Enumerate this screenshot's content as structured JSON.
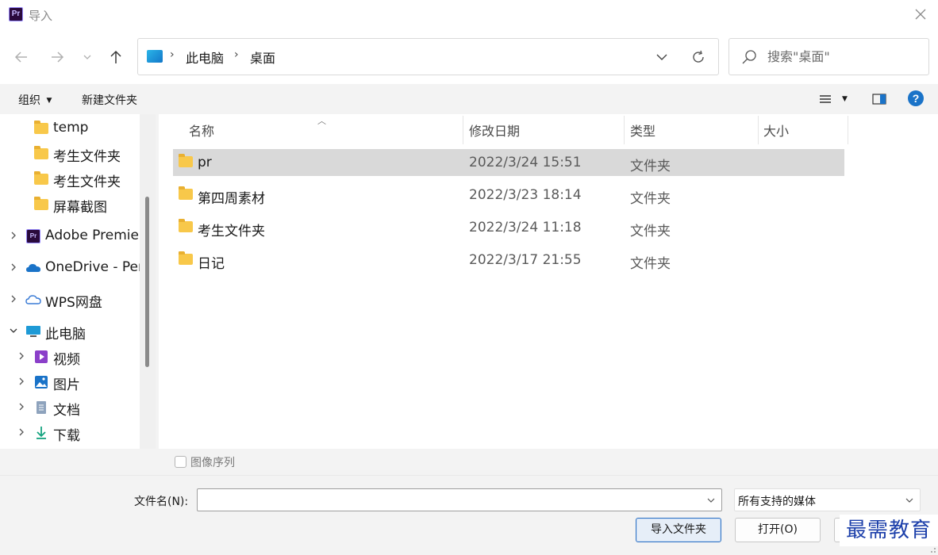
{
  "window": {
    "app_icon_text": "Pr",
    "title": "导入"
  },
  "navigation": {
    "breadcrumb": [
      "此电脑",
      "桌面"
    ],
    "search_placeholder": "搜索\"桌面\""
  },
  "toolbar": {
    "organize_label": "组织",
    "new_folder_label": "新建文件夹",
    "help_label": "?"
  },
  "sidebar": {
    "items": [
      {
        "label": "temp",
        "icon": "folder-icon",
        "expandable": false,
        "indent": 1
      },
      {
        "label": "考生文件夹",
        "icon": "folder-icon",
        "expandable": false,
        "indent": 1
      },
      {
        "label": "考生文件夹",
        "icon": "folder-icon",
        "expandable": false,
        "indent": 1
      },
      {
        "label": "屏幕截图",
        "icon": "folder-icon",
        "expandable": false,
        "indent": 1
      },
      {
        "label": "Adobe Premie",
        "icon": "premiere-icon",
        "expandable": true,
        "expanded": false,
        "indent": 0
      },
      {
        "label": "OneDrive - Per",
        "icon": "onedrive-cloud-icon",
        "expandable": true,
        "expanded": false,
        "indent": 0
      },
      {
        "label": "WPS网盘",
        "icon": "wps-cloud-icon",
        "expandable": true,
        "expanded": false,
        "indent": 0
      },
      {
        "label": "此电脑",
        "icon": "this-pc-icon",
        "expandable": true,
        "expanded": true,
        "indent": 0
      },
      {
        "label": "视频",
        "icon": "videos-icon",
        "expandable": true,
        "expanded": false,
        "indent": 1
      },
      {
        "label": "图片",
        "icon": "pictures-icon",
        "expandable": true,
        "expanded": false,
        "indent": 1
      },
      {
        "label": "文档",
        "icon": "documents-icon",
        "expandable": true,
        "expanded": false,
        "indent": 1
      },
      {
        "label": "下载",
        "icon": "downloads-icon",
        "expandable": true,
        "expanded": false,
        "indent": 1
      }
    ]
  },
  "file_list": {
    "columns": [
      "名称",
      "修改日期",
      "类型",
      "大小"
    ],
    "rows": [
      {
        "name": "pr",
        "modified": "2022/3/24 15:51",
        "type": "文件夹",
        "size": "",
        "selected": true
      },
      {
        "name": "第四周素材",
        "modified": "2022/3/23 18:14",
        "type": "文件夹",
        "size": "",
        "selected": false
      },
      {
        "name": "考生文件夹",
        "modified": "2022/3/24 11:18",
        "type": "文件夹",
        "size": "",
        "selected": false
      },
      {
        "name": "日记",
        "modified": "2022/3/17 21:55",
        "type": "文件夹",
        "size": "",
        "selected": false
      }
    ]
  },
  "image_sequence": {
    "label": "图像序列",
    "checked": false
  },
  "footer": {
    "filename_label": "文件名(N):",
    "filename_value": "",
    "file_type_value": "所有支持的媒体",
    "import_folder_button": "导入文件夹",
    "open_button": "打开(O)",
    "watermark": "最需教育"
  },
  "colors": {
    "selection": "#d9d9d9",
    "accent": "#1a73c8",
    "folder": "#f8c84a",
    "watermark": "#1c3faa"
  }
}
